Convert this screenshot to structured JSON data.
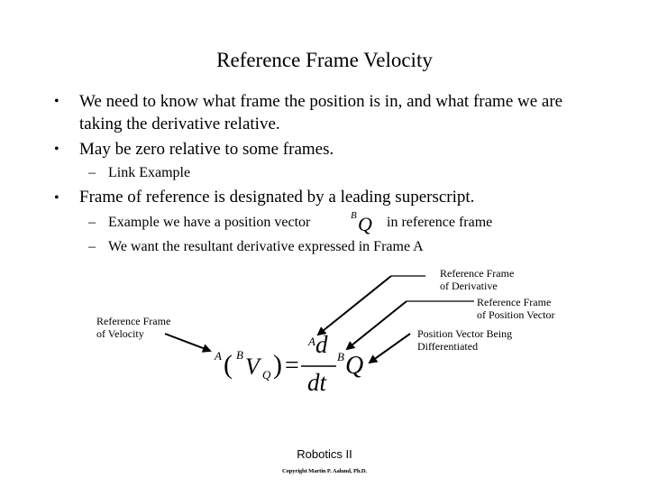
{
  "slide": {
    "title": "Reference Frame Velocity",
    "bullets": [
      {
        "marker": "•",
        "line1": "We need to know what frame the position is in, and what frame we are",
        "line2": "taking the derivative relative."
      },
      {
        "marker": "•",
        "line1": "May be zero relative to some frames."
      },
      {
        "marker": "•",
        "line1": "Frame of reference is designated by a leading superscript."
      }
    ],
    "sub_bullets": [
      {
        "marker": "–",
        "text": "Link Example"
      },
      {
        "marker": "–",
        "text_before": "Example we have a position vector",
        "text_after": "in reference frame"
      },
      {
        "marker": "–",
        "text": "We want the resultant derivative expressed in Frame A"
      }
    ],
    "inline_math": {
      "superscript": "B",
      "symbol": "Q"
    },
    "equation": {
      "lhs_outer_sup": "A",
      "lhs_open": "(",
      "lhs_inner_sup": "B",
      "lhs_symbol": "V",
      "lhs_subscript": "Q",
      "lhs_close": ")",
      "equals": "=",
      "numerator_sup": "A",
      "numerator": "d",
      "denominator": "dt",
      "rhs_sup": "B",
      "rhs_symbol": "Q"
    },
    "annotations": {
      "ref_derivative": [
        "Reference Frame",
        "of Derivative"
      ],
      "ref_position": [
        "Reference Frame",
        "of Position Vector"
      ],
      "position_vector": [
        "Position Vector Being",
        "Differentiated"
      ],
      "ref_velocity": [
        "Reference Frame",
        "of Velocity"
      ]
    },
    "footer": {
      "course": "Robotics II",
      "copyright": "Copyright Martin P. Aalund, Ph.D."
    }
  }
}
